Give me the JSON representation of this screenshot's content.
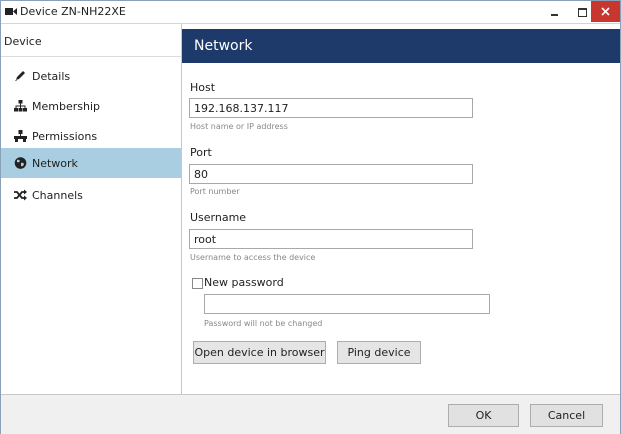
{
  "window": {
    "title": "Device ZN-NH22XE",
    "controls": {
      "minimize": "–",
      "maximize": "□",
      "close": "✕"
    },
    "accent_close": "#c7372f"
  },
  "sidebar": {
    "header": "Device",
    "items": [
      {
        "label": "Details",
        "icon": "pencil-icon"
      },
      {
        "label": "Membership",
        "icon": "sitemap-icon"
      },
      {
        "label": "Permissions",
        "icon": "hierarchy-icon"
      },
      {
        "label": "Network",
        "icon": "globe-icon",
        "active": true
      },
      {
        "label": "Channels",
        "icon": "shuffle-icon"
      }
    ],
    "active_color": "#a9cde1"
  },
  "main": {
    "header": "Network",
    "header_color": "#1d3a6b",
    "host": {
      "label": "Host",
      "value": "192.168.137.117",
      "hint": "Host name or IP address"
    },
    "port": {
      "label": "Port",
      "value": "80",
      "hint": "Port number"
    },
    "username": {
      "label": "Username",
      "value": "root",
      "hint": "Username to access the device"
    },
    "new_password": {
      "label": "New password",
      "checked": false,
      "value": "",
      "hint": "Password will not be changed"
    },
    "buttons": {
      "open_browser": "Open device in browser",
      "ping": "Ping device"
    }
  },
  "footer": {
    "ok": "OK",
    "cancel": "Cancel"
  }
}
